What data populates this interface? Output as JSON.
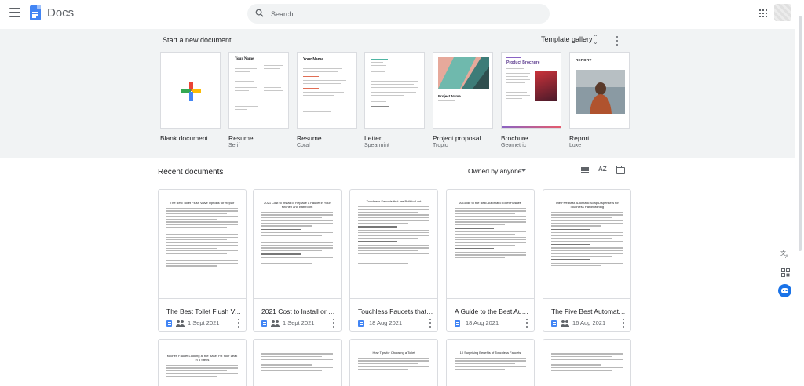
{
  "app": {
    "title": "Docs"
  },
  "search": {
    "placeholder": "Search"
  },
  "templates": {
    "heading": "Start a new document",
    "gallery_label": "Template gallery",
    "items": [
      {
        "name": "Blank document",
        "sub": ""
      },
      {
        "name": "Resume",
        "sub": "Serif",
        "preview_title": "Your Name"
      },
      {
        "name": "Resume",
        "sub": "Coral",
        "preview_title": "Your Name"
      },
      {
        "name": "Letter",
        "sub": "Spearmint"
      },
      {
        "name": "Project proposal",
        "sub": "Tropic",
        "preview_title": "Project Name"
      },
      {
        "name": "Brochure",
        "sub": "Geometric",
        "preview_title": "Product Brochure"
      },
      {
        "name": "Report",
        "sub": "Luxe",
        "preview_title": "REPORT"
      }
    ]
  },
  "recent": {
    "heading": "Recent documents",
    "owner_filter": "Owned by anyone",
    "sort_icon_text": "AZ",
    "docs": [
      {
        "title": "The Best Toilet Flush Valv...",
        "date": "1 Sept 2021",
        "preview_heading": "The Best Toilet Flush Valve Options for Repair"
      },
      {
        "title": "2021 Cost to Install or Re...",
        "date": "1 Sept 2021",
        "preview_heading": "2021 Cost to Install or Replace a Faucet in Your Kitchen and Bathroom"
      },
      {
        "title": "Touchless Faucets that a...",
        "date": "18 Aug 2021",
        "preview_heading": "Touchless Faucets that are Built to Last"
      },
      {
        "title": "A Guide to the Best Auto...",
        "date": "18 Aug 2021",
        "preview_heading": "A Guide to the Best Automatic Toilet Flushes"
      },
      {
        "title": "The Five Best Automatic ...",
        "date": "16 Aug 2021",
        "preview_heading": "The Five Best Automatic Soap Dispensers for Touchless Handwashing"
      }
    ],
    "more_docs": [
      {
        "preview_heading": "Kitchen Faucet Looking at the Base: Fix Your Leak in 5 Steps"
      },
      {
        "preview_heading": ""
      },
      {
        "preview_heading": "How Tips for Choosing a Toilet"
      },
      {
        "preview_heading": "10 Surprising Benefits of Touchless Faucets"
      },
      {
        "preview_heading": ""
      }
    ]
  },
  "colors": {
    "accent": "#4285f4",
    "template_bg": "#f1f3f4"
  }
}
